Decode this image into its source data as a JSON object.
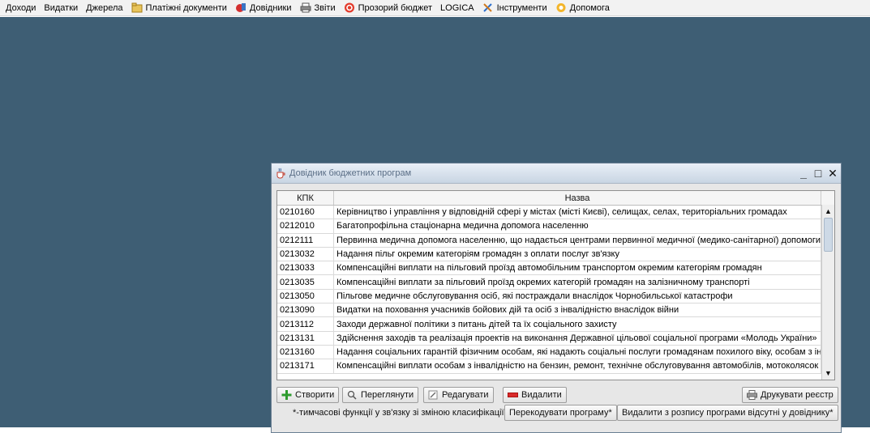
{
  "menubar": {
    "items": [
      {
        "label": "Доходи",
        "icon": ""
      },
      {
        "label": "Видатки",
        "icon": ""
      },
      {
        "label": "Джерела",
        "icon": ""
      },
      {
        "label": "Платіжні документи",
        "icon": "folder-icon"
      },
      {
        "label": "Довідники",
        "icon": "book-icon"
      },
      {
        "label": "Звіти",
        "icon": "printer-icon"
      },
      {
        "label": "Прозорий бюджет",
        "icon": "prozorro-icon"
      },
      {
        "label": "LOGICA",
        "icon": ""
      },
      {
        "label": "Інструменти",
        "icon": "tools-icon"
      },
      {
        "label": "Допомога",
        "icon": "help-icon"
      }
    ]
  },
  "window": {
    "title": "Довідник бюджетних програм",
    "icon": "coffee-app-icon",
    "controls": {
      "minimize": "_",
      "maximize": "□",
      "close": "✕"
    }
  },
  "table": {
    "columns": [
      "КПК",
      "Назва"
    ],
    "rows": [
      [
        "0210160",
        "Керівництво і управління у відповідній сфері у містах (місті Києві), селищах, селах, територіальних громадах"
      ],
      [
        "0212010",
        "Багатопрофільна стаціонарна медична допомога населенню"
      ],
      [
        "0212111",
        "Первинна медична допомога населенню, що надається центрами первинної медичної (медико-санітарної) допомоги"
      ],
      [
        "0213032",
        "Надання пільг окремим категоріям громадян з оплати послуг зв'язку"
      ],
      [
        "0213033",
        "Компенсаційні виплати на пільговий проїзд автомобільним транспортом окремим категоріям громадян"
      ],
      [
        "0213035",
        "Компенсаційні виплати за пільговий проїзд окремих категорій громадян на залізничному транспорті"
      ],
      [
        "0213050",
        "Пільгове медичне обслуговування осіб, які постраждали внаслідок Чорнобильської катастрофи"
      ],
      [
        "0213090",
        "Видатки на поховання учасників бойових дій та осіб з інвалідністю внаслідок війни"
      ],
      [
        "0213112",
        "Заходи державної політики з питань дітей та їх соціального захисту"
      ],
      [
        "0213131",
        "Здійснення заходів та реалізація проектів на виконання Державної цільової соціальної програми «Молодь України»"
      ],
      [
        "0213160",
        "Надання соціальних гарантій фізичним особам, які надають соціальні послуги громадянам похилого віку, особам з ін..."
      ],
      [
        "0213171",
        "Компенсаційні виплати особам з інвалідністю на бензин, ремонт, технічне обслуговування автомобілів, мотоколясок і..."
      ]
    ]
  },
  "buttons": {
    "create": "Створити",
    "view": "Переглянути",
    "edit": "Редагувати",
    "delete": "Видалити",
    "print": "Друкувати реєстр",
    "recode": "Перекодувати програму*",
    "remove_missing": "Видалити з розпису програми відсутні у довіднику*"
  },
  "note": "*-тимчасові функції у зв'язку зі зміною класифікації",
  "colors": {
    "desktop": "#3e5e74",
    "accent_red": "#d92b2b",
    "accent_green": "#2e9b2e"
  }
}
